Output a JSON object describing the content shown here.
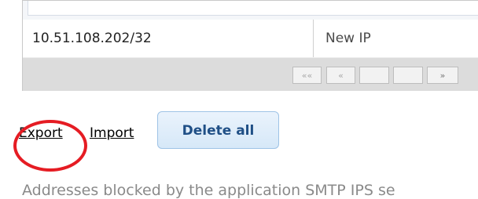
{
  "table": {
    "rows": [
      {
        "ip": "10.51.108.202/32",
        "description": "New IP"
      }
    ],
    "pager": {
      "first_label": "««",
      "prev_label": "«",
      "next_label": "»"
    }
  },
  "actions": {
    "export_label": "Export",
    "import_label": "Import",
    "delete_all_label": "Delete all"
  },
  "info_text": "Addresses blocked by the application SMTP IPS se",
  "colors": {
    "accent_button_text": "#1f4f86",
    "highlight": "#e51c23"
  }
}
